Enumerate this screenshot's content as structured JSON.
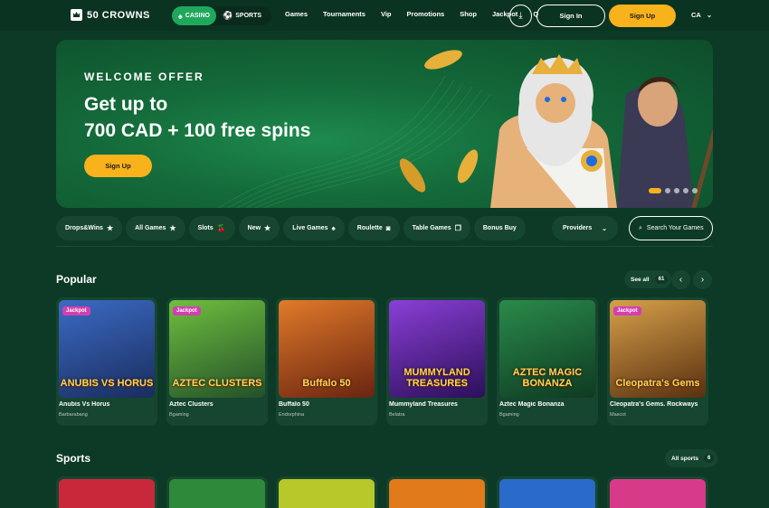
{
  "header": {
    "logo_text": "50 CROWNS",
    "modes": [
      {
        "label": "CASINO",
        "icon": "spade-icon",
        "active": true
      },
      {
        "label": "SPORTS",
        "icon": "soccer-ball-icon",
        "active": false
      }
    ],
    "nav": [
      "Games",
      "Tournaments",
      "Vip",
      "Promotions",
      "Shop",
      "Jackpot",
      "Q"
    ],
    "sign_in": "Sign In",
    "sign_up": "Sign Up",
    "language": "CA"
  },
  "banner": {
    "eyebrow": "WELCOME OFFER",
    "title_line1": "Get up to",
    "title_line2": "700 CAD + 100 free spins",
    "cta": "Sign Up",
    "slides": 5,
    "active_slide": 1
  },
  "filters": {
    "pills": [
      {
        "label": "Drops&Wins",
        "icon": "★"
      },
      {
        "label": "All Games",
        "icon": "★"
      },
      {
        "label": "Slots",
        "icon": "🍒"
      },
      {
        "label": "New",
        "icon": "★"
      },
      {
        "label": "Live Games",
        "icon": "♠"
      },
      {
        "label": "Roulette",
        "icon": "◙"
      },
      {
        "label": "Table Games",
        "icon": "❐"
      },
      {
        "label": "Bonus Buy",
        "icon": ""
      }
    ],
    "providers": "Providers",
    "search_placeholder": "Search Your Games"
  },
  "popular": {
    "title": "Popular",
    "see_all": "See all",
    "count": "61",
    "games": [
      {
        "title": "Anubis Vs Horus",
        "provider": "Barbarabang",
        "jackpot": true,
        "art": "ANUBIS VS HORUS",
        "bg1": "#3b6bc4",
        "bg2": "#1a2c5e"
      },
      {
        "title": "Aztec Clusters",
        "provider": "Bgaming",
        "jackpot": true,
        "art": "AZTEC CLUSTERS",
        "bg1": "#6fbf3e",
        "bg2": "#24502a"
      },
      {
        "title": "Buffalo 50",
        "provider": "Endorphina",
        "jackpot": false,
        "art": "Buffalo 50",
        "bg1": "#e07a2a",
        "bg2": "#6a2410"
      },
      {
        "title": "Mummyland Treasures",
        "provider": "Belatra",
        "jackpot": false,
        "art": "MUMMYLAND TREASURES",
        "bg1": "#8a3fd6",
        "bg2": "#2c0f5a"
      },
      {
        "title": "Aztec Magic Bonanza",
        "provider": "Bgaming",
        "jackpot": false,
        "art": "AZTEC MAGIC BONANZA",
        "bg1": "#2a8a4a",
        "bg2": "#0e3a22"
      },
      {
        "title": "Cleopatra's Gems. Rockways",
        "provider": "Mascot",
        "jackpot": true,
        "art": "Cleopatra's Gems",
        "bg1": "#d6a04a",
        "bg2": "#5a3010"
      }
    ],
    "jackpot_label": "Jackpot"
  },
  "sports": {
    "title": "Sports",
    "see_all": "All sports",
    "count": "6",
    "cards": [
      {
        "bg": "#c8283a"
      },
      {
        "bg": "#2e8a3a"
      },
      {
        "bg": "#b6c82a"
      },
      {
        "bg": "#e07a1a"
      },
      {
        "bg": "#2a6ac8"
      },
      {
        "bg": "#d83a8a"
      }
    ]
  }
}
